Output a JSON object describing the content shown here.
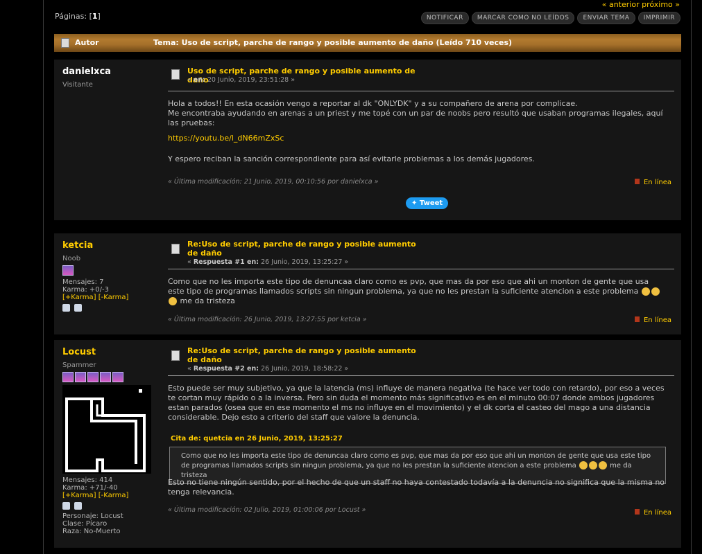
{
  "nav": {
    "prev": "« anterior",
    "next": "próximo »"
  },
  "pages": {
    "label": "Páginas:",
    "current": "1"
  },
  "toolbar": [
    "NOTIFICAR",
    "MARCAR COMO NO LEÍDOS",
    "ENVIAR TEMA",
    "IMPRIMIR"
  ],
  "header": {
    "author_label": "Autor",
    "topic": "Tema: Uso de script, parche de rango y posible aumento de daño  (Leído 710 veces)"
  },
  "posts": [
    {
      "username": "danielxca",
      "rank": "Visitante",
      "subject": "Uso de script, parche de rango y posible aumento de daño",
      "meta_prefix": "« ",
      "meta_label": "en:",
      "meta_date": " 20 Junio, 2019, 23:51:28 »",
      "body": [
        "Hola a todos!! En esta ocasión vengo a reportar al dk \"ONLYDK\" y a su compañero de arena por complicae.",
        "Me encontraba ayudando en arenas a un priest y me topé con un par de noobs pero resultó que usaban programas ilegales, aquí las pruebas:"
      ],
      "link": "https://youtu.be/l_dN66mZxSc",
      "body_end": "Y espero reciban la sanción correspondiente para así evitarle problemas a los demás jugadores.",
      "modified": "« Última modificación: 21 Junio, 2019, 00:10:56 por danielxca »",
      "online": "En línea",
      "tweet": "Tweet"
    },
    {
      "username": "ketcia",
      "rank": "Noob",
      "posts_label": "Mensajes: 7",
      "karma_label": "Karma: +0/-3",
      "karma_plus": "[+Karma]",
      "karma_minus": "[-Karma]",
      "subject": "Re:Uso de script, parche de rango y posible aumento de daño",
      "meta_prefix": "« ",
      "meta_label": "Respuesta #1 en:",
      "meta_date": " 26 Junio, 2019, 13:25:27 »",
      "body_a": "Como que no les importa este tipo de denuncaa claro como es pvp, que mas da por eso que ahi un monton de gente que usa este tipo de programas llamados scripts sin ningun problema, ya que no les prestan la suficiente atencion a este problema",
      "body_b": "me da tristeza",
      "modified": "« Última modificación: 26 Junio, 2019, 13:27:55 por ketcia »",
      "online": "En línea"
    },
    {
      "username": "Locust",
      "rank": "Spammer",
      "posts_label": "Mensajes: 414",
      "karma_label": "Karma: +71/-40",
      "karma_plus": "[+Karma]",
      "karma_minus": "[-Karma]",
      "char": "Personaje: Locust",
      "class": "Clase: Pícaro",
      "race": "Raza: No-Muerto",
      "subject": "Re:Uso de script, parche de rango y posible aumento de daño",
      "meta_prefix": "« ",
      "meta_label": "Respuesta #2 en:",
      "meta_date": " 26 Junio, 2019, 18:58:22 »",
      "body": "Esto puede ser muy subjetivo, ya que la latencia (ms) influye de manera negativa (te hace ver todo con retardo), por eso a veces te cortan muy rápido o a la inversa. Pero sin duda el momento más significativo es en el minuto 00:07 donde ambos jugadores estan parados (osea que en ese momento el ms no influye en el movimiento) y el dk corta el casteo del mago a una distancia considerable. Dejo esto a criterio del staff que valore la denuncia.",
      "quote_head": "Cita de: quetcia en 26 Junio, 2019, 13:25:27",
      "quote_a": "Como que no les importa este tipo de denuncaa claro como es pvp, que mas da por eso que ahi un monton de gente que usa este tipo de programas llamados scripts sin ningun problema, ya que no les prestan la suficiente atencion a este problema",
      "quote_b": "me da tristeza",
      "body_after": "Esto no tiene ningún sentido, por el hecho de que un staff no haya contestado todavía a la denuncia no significa que la misma no tenga relevancia.",
      "modified": "« Última modificación: 02 Julio, 2019, 01:00:06 por Locust »",
      "online": "En línea"
    }
  ]
}
